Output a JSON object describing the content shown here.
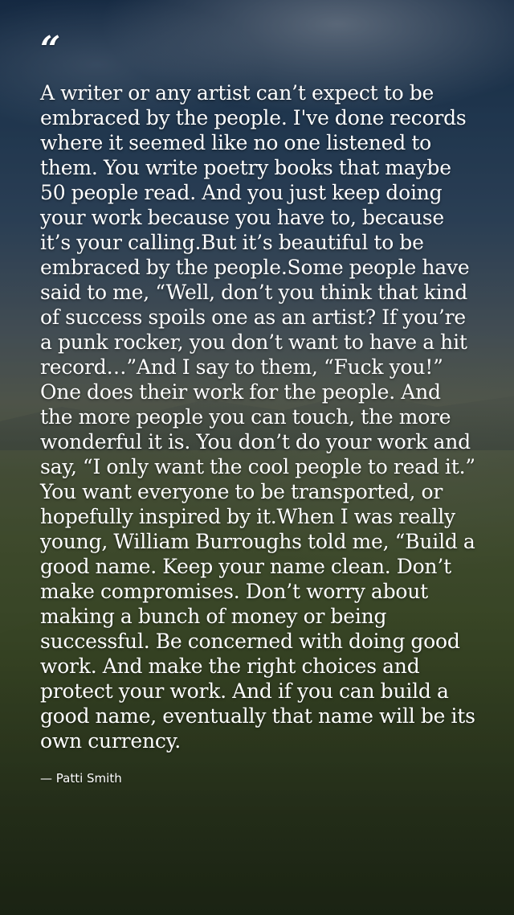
{
  "quote": {
    "mark": "“",
    "text": "A writer or any artist can’t expect to be embraced by the people. I've done records where it seemed like no one listened to them. You write poetry books that maybe 50 people read. And you just keep doing your work because you have to, because it’s your calling.But it’s beautiful to be embraced by the people.Some people have said to me, “Well, don’t you think that kind of success spoils one as an artist? If you’re a punk rocker, you don’t want to have a hit record…”And I say to them, “Fuck you!” One does their work for the people. And the more people you can touch, the more wonderful it is. You don’t do your work and say, “I only want the cool people to read it.” You want everyone to be transported, or hopefully inspired by it.When I was really young, William Burroughs told me, “Build a good name. Keep your name clean. Don’t make compromises. Don’t worry about making a bunch of money or being successful. Be concerned with doing good work. And make the right choices and protect your work. And if you can build a good name, eventually that name will be its own currency.",
    "attribution": "— Patti Smith"
  },
  "background": {
    "description_icon": "mountain-landscape-photo",
    "text_color": "#ffffff"
  }
}
